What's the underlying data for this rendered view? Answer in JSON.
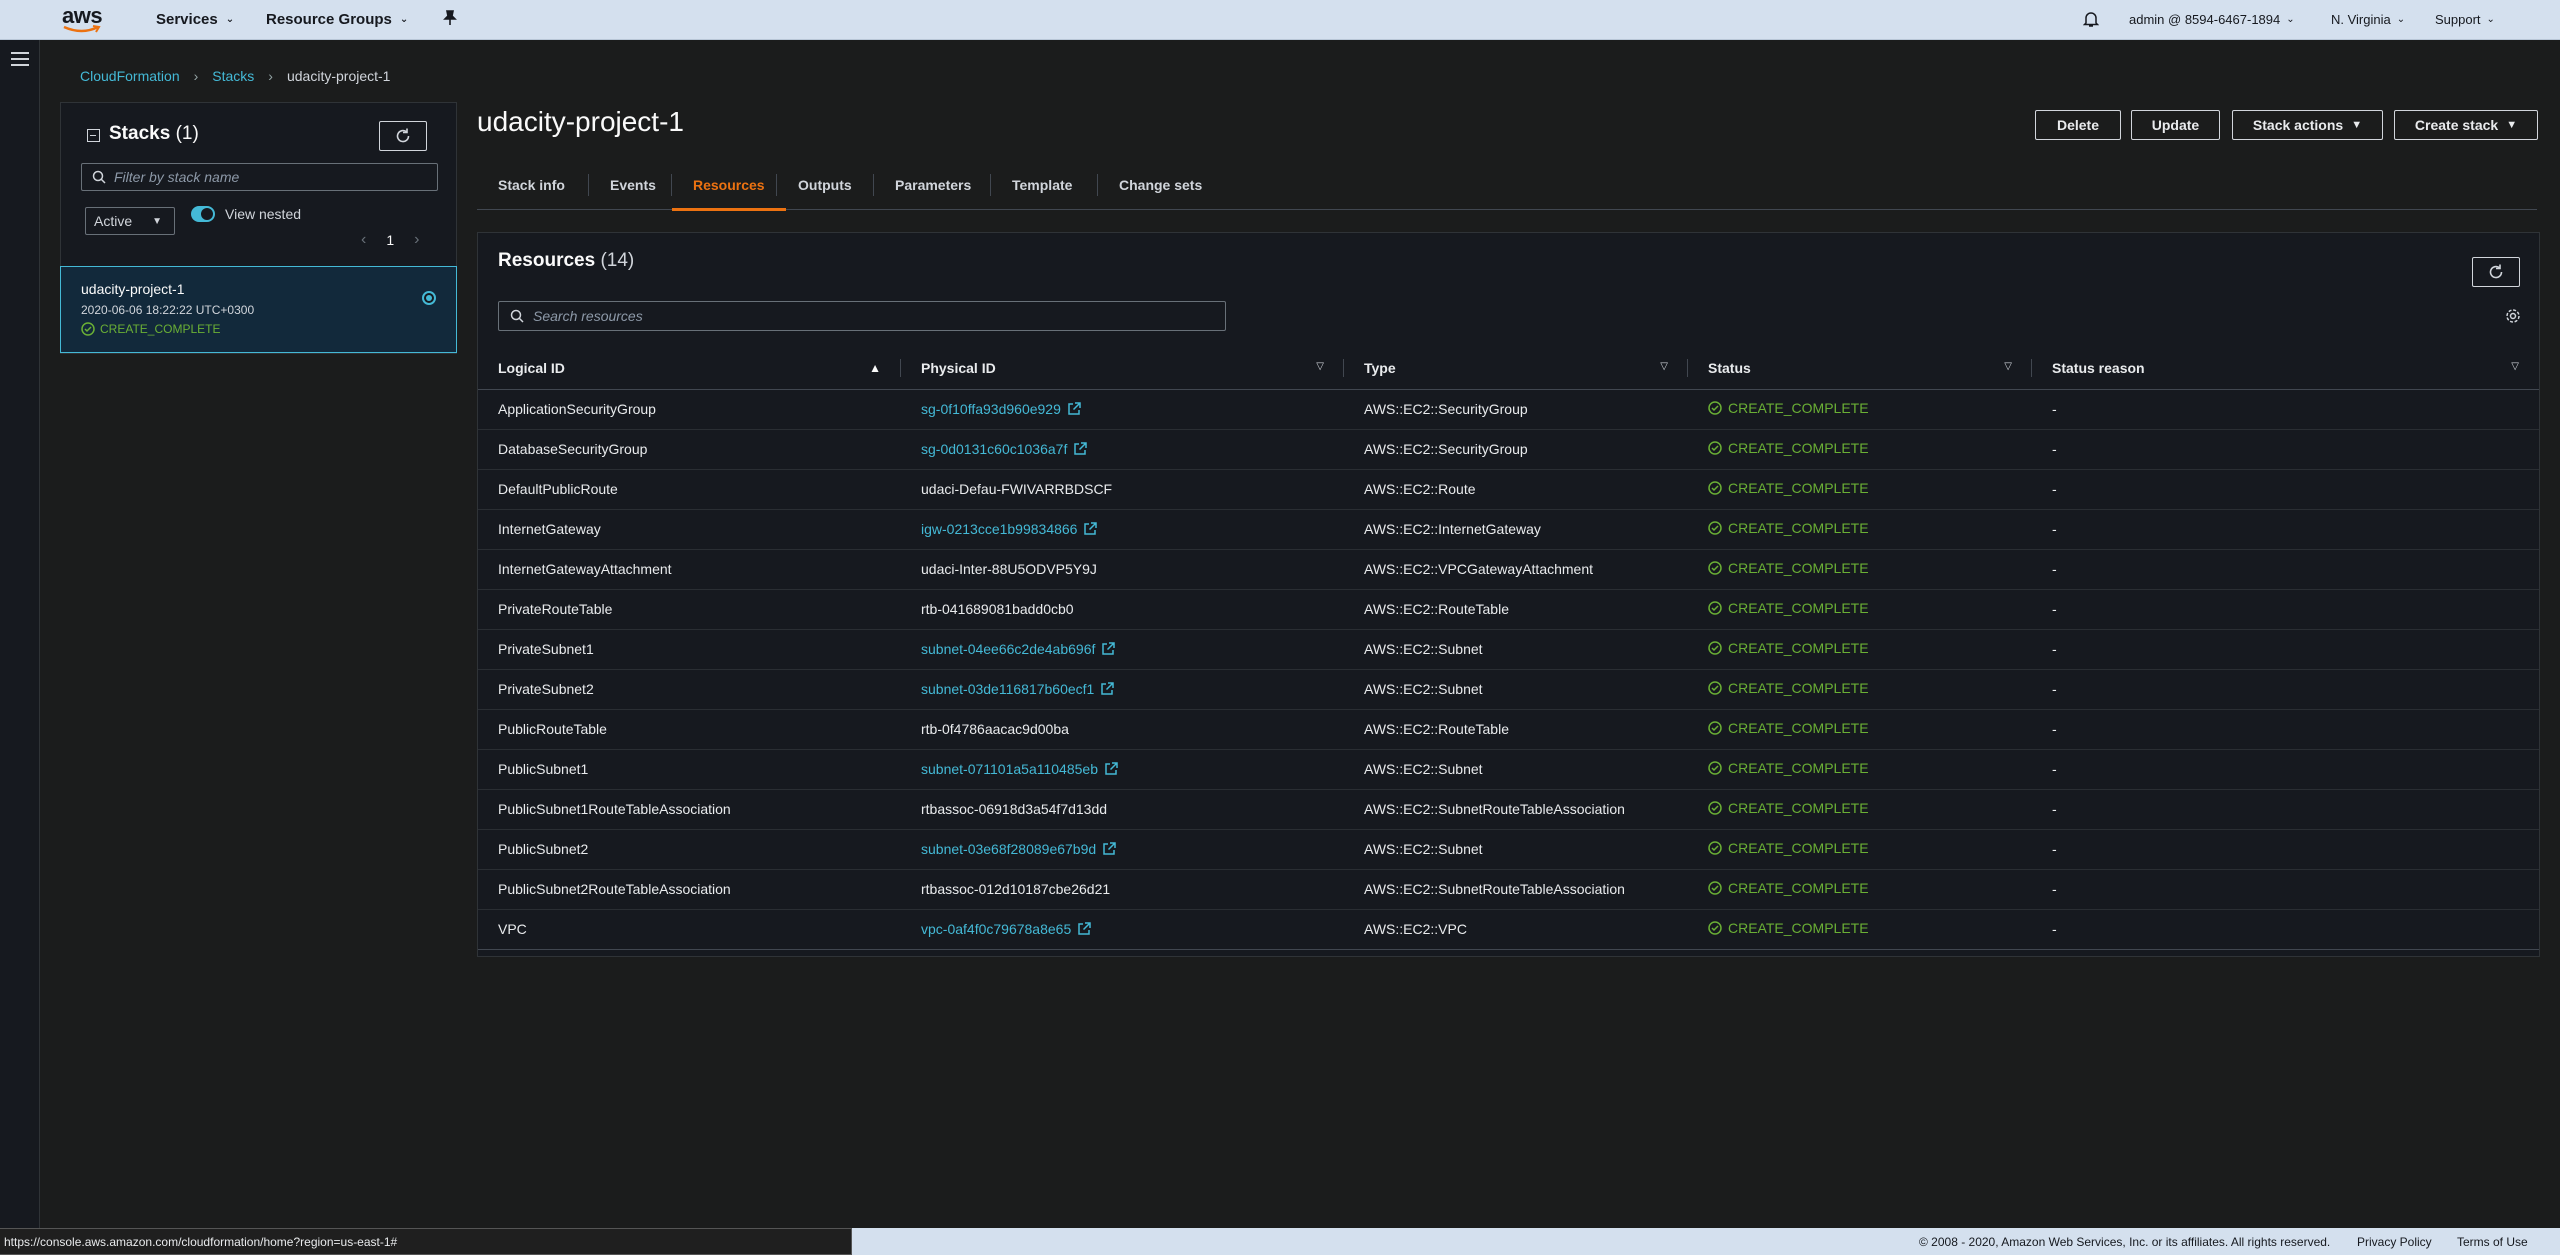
{
  "nav": {
    "logo": "aws",
    "services": "Services",
    "resource_groups": "Resource Groups",
    "account": "admin @ 8594-6467-1894",
    "region": "N. Virginia",
    "support": "Support"
  },
  "breadcrumb": [
    "CloudFormation",
    "Stacks",
    "udacity-project-1"
  ],
  "stacks_panel": {
    "title": "Stacks",
    "count": "(1)",
    "filter_placeholder": "Filter by stack name",
    "status_filter": "Active",
    "toggle_label": "View nested",
    "page": "1",
    "stack": {
      "name": "udacity-project-1",
      "date": "2020-06-06 18:22:22 UTC+0300",
      "status": "CREATE_COMPLETE"
    }
  },
  "page_title": "udacity-project-1",
  "actions": {
    "delete": "Delete",
    "update": "Update",
    "stack_actions": "Stack actions",
    "create_stack": "Create stack"
  },
  "tabs": [
    "Stack info",
    "Events",
    "Resources",
    "Outputs",
    "Parameters",
    "Template",
    "Change sets"
  ],
  "resources": {
    "title": "Resources",
    "count": "(14)",
    "search_placeholder": "Search resources",
    "columns": [
      "Logical ID",
      "Physical ID",
      "Type",
      "Status",
      "Status reason"
    ],
    "rows": [
      {
        "logical": "ApplicationSecurityGroup",
        "physical": "sg-0f10ffa93d960e929",
        "link": true,
        "type": "AWS::EC2::SecurityGroup",
        "status": "CREATE_COMPLETE",
        "reason": "-"
      },
      {
        "logical": "DatabaseSecurityGroup",
        "physical": "sg-0d0131c60c1036a7f",
        "link": true,
        "type": "AWS::EC2::SecurityGroup",
        "status": "CREATE_COMPLETE",
        "reason": "-"
      },
      {
        "logical": "DefaultPublicRoute",
        "physical": "udaci-Defau-FWIVARRBDSCF",
        "link": false,
        "type": "AWS::EC2::Route",
        "status": "CREATE_COMPLETE",
        "reason": "-"
      },
      {
        "logical": "InternetGateway",
        "physical": "igw-0213cce1b99834866",
        "link": true,
        "type": "AWS::EC2::InternetGateway",
        "status": "CREATE_COMPLETE",
        "reason": "-"
      },
      {
        "logical": "InternetGatewayAttachment",
        "physical": "udaci-Inter-88U5ODVP5Y9J",
        "link": false,
        "type": "AWS::EC2::VPCGatewayAttachment",
        "status": "CREATE_COMPLETE",
        "reason": "-"
      },
      {
        "logical": "PrivateRouteTable",
        "physical": "rtb-041689081badd0cb0",
        "link": false,
        "type": "AWS::EC2::RouteTable",
        "status": "CREATE_COMPLETE",
        "reason": "-"
      },
      {
        "logical": "PrivateSubnet1",
        "physical": "subnet-04ee66c2de4ab696f",
        "link": true,
        "type": "AWS::EC2::Subnet",
        "status": "CREATE_COMPLETE",
        "reason": "-"
      },
      {
        "logical": "PrivateSubnet2",
        "physical": "subnet-03de116817b60ecf1",
        "link": true,
        "type": "AWS::EC2::Subnet",
        "status": "CREATE_COMPLETE",
        "reason": "-"
      },
      {
        "logical": "PublicRouteTable",
        "physical": "rtb-0f4786aacac9d00ba",
        "link": false,
        "type": "AWS::EC2::RouteTable",
        "status": "CREATE_COMPLETE",
        "reason": "-"
      },
      {
        "logical": "PublicSubnet1",
        "physical": "subnet-071101a5a110485eb",
        "link": true,
        "type": "AWS::EC2::Subnet",
        "status": "CREATE_COMPLETE",
        "reason": "-"
      },
      {
        "logical": "PublicSubnet1RouteTableAssociation",
        "physical": "rtbassoc-06918d3a54f7d13dd",
        "link": false,
        "type": "AWS::EC2::SubnetRouteTableAssociation",
        "status": "CREATE_COMPLETE",
        "reason": "-"
      },
      {
        "logical": "PublicSubnet2",
        "physical": "subnet-03e68f28089e67b9d",
        "link": true,
        "type": "AWS::EC2::Subnet",
        "status": "CREATE_COMPLETE",
        "reason": "-"
      },
      {
        "logical": "PublicSubnet2RouteTableAssociation",
        "physical": "rtbassoc-012d10187cbe26d21",
        "link": false,
        "type": "AWS::EC2::SubnetRouteTableAssociation",
        "status": "CREATE_COMPLETE",
        "reason": "-"
      },
      {
        "logical": "VPC",
        "physical": "vpc-0af4f0c79678a8e65",
        "link": true,
        "type": "AWS::EC2::VPC",
        "status": "CREATE_COMPLETE",
        "reason": "-"
      }
    ]
  },
  "footer": {
    "status_url": "https://console.aws.amazon.com/cloudformation/home?region=us-east-1#",
    "copyright": "© 2008 - 2020, Amazon Web Services, Inc. or its affiliates. All rights reserved.",
    "privacy": "Privacy Policy",
    "terms": "Terms of Use"
  },
  "colors": {
    "accent_link": "#44b9d6",
    "active_tab": "#ec7211",
    "success": "#6aaf35",
    "nav_bg": "#d4e0ee",
    "page_bg": "#1b1c1c"
  },
  "icons": [
    "aws-logo",
    "pin-icon",
    "bell-icon",
    "menu-icon",
    "refresh-icon",
    "search-icon",
    "check-circle-icon",
    "external-link-icon",
    "gear-icon",
    "caret-down-icon",
    "sort-icon"
  ]
}
